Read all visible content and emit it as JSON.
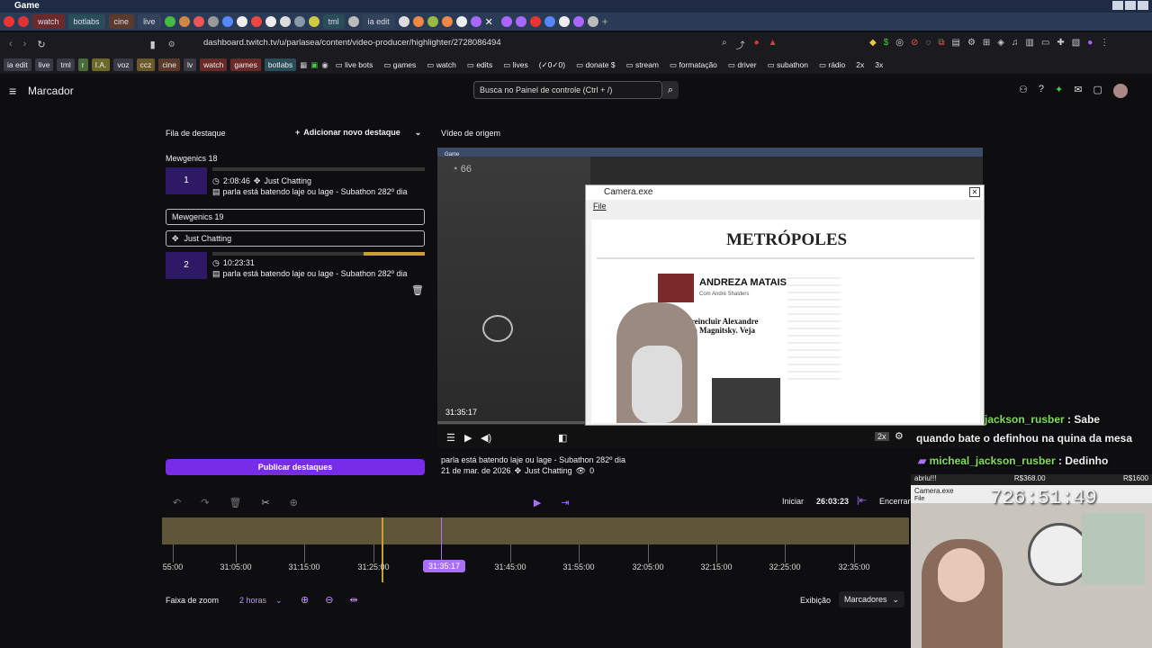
{
  "window": {
    "title": "Game"
  },
  "browser_tabs": [
    {
      "label": "watch",
      "style": "red"
    },
    {
      "label": "botlabs",
      "style": "teal"
    },
    {
      "label": "cine",
      "style": "brown"
    },
    {
      "label": "live",
      "style": "dark"
    },
    {
      "label": "tml",
      "style": "teal"
    },
    {
      "label": "ia edit",
      "style": "dark"
    }
  ],
  "address_bar": {
    "url": "dashboard.twitch.tv/u/parlasea/content/video-producer/highlighter/2728086494"
  },
  "bookmarks": [
    "ia edit",
    "live",
    "tml",
    "r",
    "I.A.",
    "voz",
    "ccz",
    "cine",
    "lv",
    "watch",
    "games",
    "botlabs",
    "live bots",
    "games",
    "watch",
    "edits",
    "lives",
    "(✓0✓0)",
    "donate $",
    "stream",
    "formatação",
    "driver",
    "subathon",
    "rádio",
    "2x",
    "3x"
  ],
  "topbar": {
    "title": "Marcador",
    "search_placeholder": "Busca no Painel de controle (Ctrl + /)"
  },
  "highlights": {
    "queue_title": "Fila de destaque",
    "add_label": "Adicionar novo destaque",
    "group1_title": "Mewgenics 18",
    "item1": {
      "num": "1",
      "time": "2:08:46",
      "category": "Just Chatting",
      "text": "parla está batendo laje ou lage - Subathon 282º dia"
    },
    "group2_title": "Mewgenics 19",
    "group2_category": "Just Chatting",
    "item2": {
      "num": "2",
      "time": "10:23:31",
      "text": "parla está batendo laje ou lage - Subathon 282º dia"
    },
    "publish_label": "Publicar destaques"
  },
  "source_video": {
    "title": "Vídeo de origem",
    "timestamp": "31:35:17",
    "game_label": "Game",
    "score": "66",
    "speed": "2x",
    "video_title": "parla está batendo laje ou lage - Subathon 282º dia",
    "date": "21 de mar. de 2026",
    "category": "Just Chatting",
    "viewers": "0"
  },
  "camera_window": {
    "title": "Camera.exe",
    "menu_file": "File",
    "site_logo": "METRÓPOLES",
    "headline_person": "ANDREZA MATAIS",
    "headline_sub": "Com André Shalders",
    "story": "valia reincluir Alexandre raes na Magnitsky. Veja"
  },
  "timeline": {
    "start_label": "Iniciar",
    "start_time": "26:03:23",
    "end_label": "Encerrar",
    "cursor": "31:35:17",
    "ticks": [
      "55:00",
      "31:05:00",
      "31:15:00",
      "31:25:00",
      "31:45:00",
      "31:55:00",
      "32:05:00",
      "32:15:00",
      "32:25:00",
      "32:35:00"
    ],
    "zoom_label": "Faixa de zoom",
    "zoom_value": "2 horas",
    "view_label": "Exibição",
    "markers_label": "Marcadores"
  },
  "chat": [
    {
      "user": "jackson_rusber",
      "msg": "Sabe"
    },
    {
      "user": "",
      "msg": "quando bate o definhou na quina da mesa"
    },
    {
      "user": "micheal_jackson_rusber",
      "msg": "Dedinho"
    }
  ],
  "overlay": {
    "subathon_left": "abriu!!!",
    "money1": "R$368.00",
    "money2": "R$1600",
    "clock": "726:51:49",
    "cam_title": "Camera.exe",
    "file": "File"
  }
}
